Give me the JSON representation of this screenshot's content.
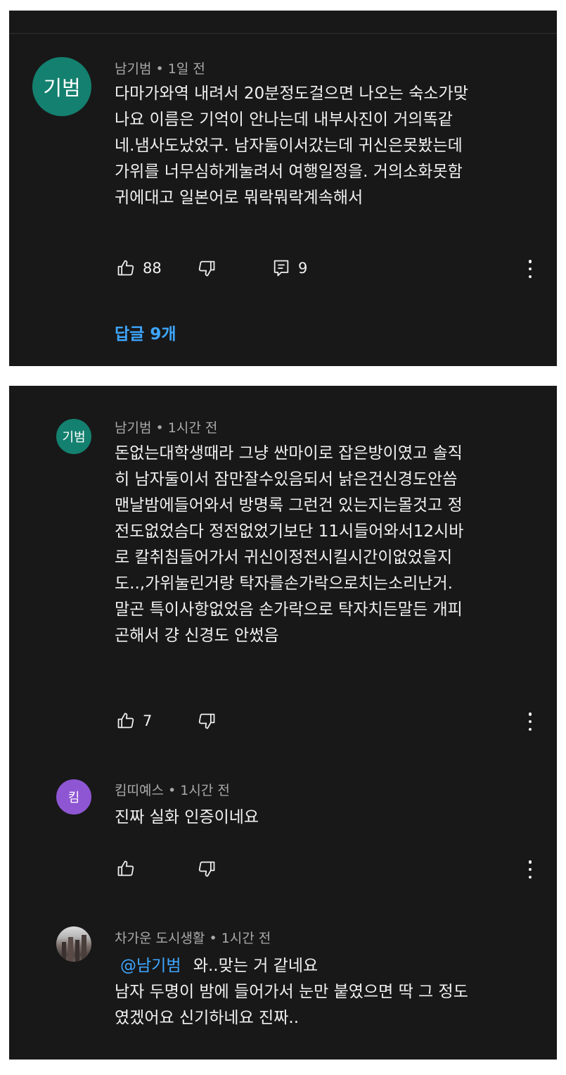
{
  "comment1": {
    "avatar_text": "기범",
    "author": "남기범",
    "separator": "•",
    "time": "1일 전",
    "lines": [
      "다마가와역 내려서 20분정도걸으면 나오는 숙소가맞",
      "나요 이름은 기억이 안나는데 내부사진이 거의똑같",
      "네.냄사도났었구. 남자둘이서갔는데 귀신은못봤는데",
      "가위를 너무심하게눌려서 여행일정을. 거의소화못함",
      "귀에대고 일본어로 뭐락뭐락계속해서"
    ],
    "likes": "88",
    "replies_count": "9",
    "replies_link": "답글 9개"
  },
  "reply1": {
    "avatar_text": "기범",
    "author": "남기범",
    "separator": "•",
    "time": "1시간 전",
    "lines": [
      "돈없는대학생때라 그냥 싼마이로 잡은방이였고 솔직",
      "히 남자둘이서 잠만잘수있음되서 낡은건신경도안씀",
      "맨날밤에들어와서 방명록 그런건 있는지는몰것고 정",
      "전도없었슴다 정전없었기보단 11시들어와서12시바",
      "로 칼취침들어가서 귀신이정전시킬시간이없었을지",
      "도..,가위눌린거랑 탁자를손가락으로치는소리난거.",
      "말곤 특이사항없었음 손가락으로 탁자치든말든 개피",
      "곤해서 걍 신경도 안썼음"
    ],
    "likes": "7"
  },
  "reply2": {
    "avatar_text": "킴",
    "author": "킴띠예스",
    "separator": "•",
    "time": "1시간 전",
    "lines": [
      "진짜 실화 인증이네요"
    ]
  },
  "reply3": {
    "author": "차가운 도시생활",
    "separator": "•",
    "time": "1시간 전",
    "mention": "@남기범",
    "first_line_rest": "와..맞는 거  같네요",
    "lines": [
      "남자 두명이 밤에 들어가서 눈만 붙였으면 딱 그 정도",
      "였겠어요 신기하네요 진짜.."
    ]
  },
  "icons": {
    "like": "thumbs-up-icon",
    "dislike": "thumbs-down-icon",
    "reply": "comment-icon",
    "more": "more-vertical-icon"
  },
  "colors": {
    "panel_bg": "#181818",
    "text": "#f1f1f1",
    "meta": "#aaaaaa",
    "link": "#3ea6ff",
    "avatar_teal": "#14806f",
    "avatar_purple": "#8e56d3"
  }
}
